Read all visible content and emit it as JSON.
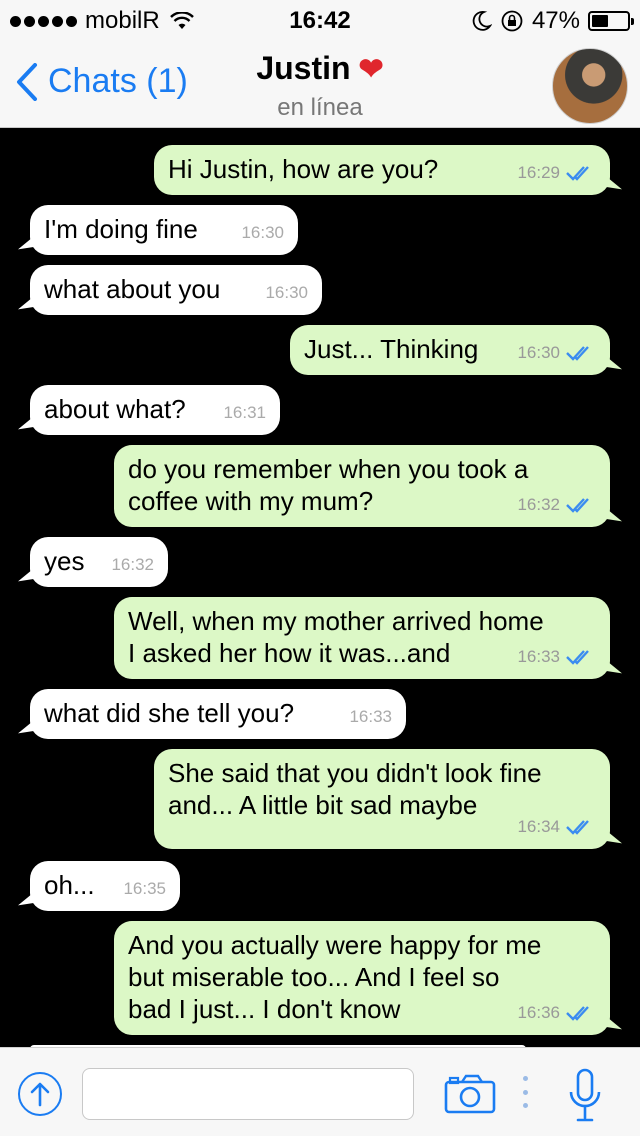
{
  "status_bar": {
    "carrier": "mobilR",
    "time": "16:42",
    "battery_text": "47%",
    "battery_level": 0.47
  },
  "header": {
    "back_label": "Chats (1)",
    "contact_name": "Justin",
    "contact_emoji": "❤",
    "contact_status": "en línea"
  },
  "messages": [
    {
      "dir": "out",
      "text": "Hi Justin, how are you?",
      "time": "16:29",
      "read": true
    },
    {
      "dir": "in",
      "text": "I'm doing fine",
      "time": "16:30"
    },
    {
      "dir": "in",
      "text": "what about you",
      "time": "16:30"
    },
    {
      "dir": "out",
      "text": "Just... Thinking",
      "time": "16:30",
      "read": true
    },
    {
      "dir": "in",
      "text": "about what?",
      "time": "16:31"
    },
    {
      "dir": "out",
      "text": "do you remember when you took a\ncoffee with my mum?",
      "time": "16:32",
      "read": true
    },
    {
      "dir": "in",
      "text": "yes",
      "time": "16:32"
    },
    {
      "dir": "out",
      "text": "Well, when my mother arrived home\nI asked her how it was...and",
      "time": "16:33",
      "read": true
    },
    {
      "dir": "in",
      "text": "what did she tell you?",
      "time": "16:33"
    },
    {
      "dir": "out",
      "text": "She said that you didn't look fine\nand... A little bit sad maybe",
      "time": "16:34",
      "read": true
    },
    {
      "dir": "in",
      "text": "oh...",
      "time": "16:35"
    },
    {
      "dir": "out",
      "text": "And you actually were happy for me\nbut miserable too... And I feel so\nbad I just... I don't know",
      "time": "16:36",
      "read": true
    }
  ],
  "input": {
    "placeholder": "",
    "value": ""
  },
  "icons": {
    "back": "chevron-left-icon",
    "share": "arrow-up-icon",
    "camera": "camera-icon",
    "mic": "microphone-icon",
    "read_receipt": "double-check-icon"
  },
  "colors": {
    "accent": "#1a7cf2",
    "outgoing_bubble": "#dcf8c6",
    "incoming_bubble": "#ffffff",
    "chat_background": "#000000",
    "heart": "#e0262d"
  }
}
